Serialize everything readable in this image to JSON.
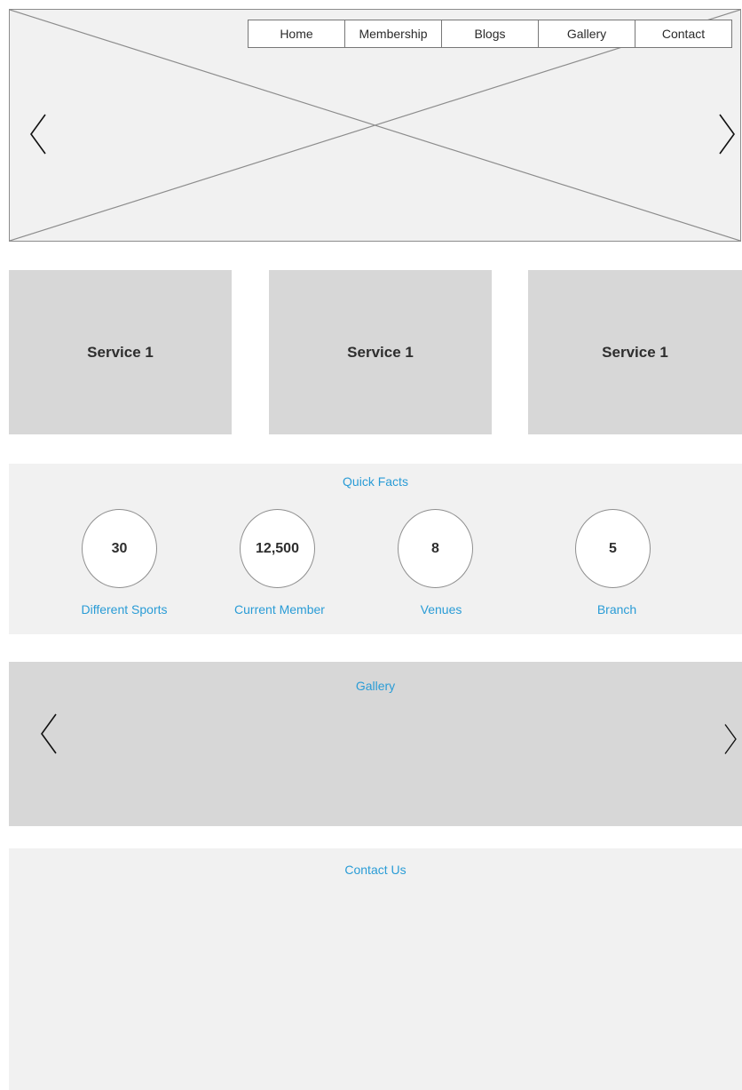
{
  "nav": {
    "items": [
      "Home",
      "Membership",
      "Blogs",
      "Gallery",
      "Contact"
    ]
  },
  "hero": {
    "prev_icon": "chevron-left-icon",
    "next_icon": "chevron-right-icon"
  },
  "services": [
    {
      "label": "Service 1"
    },
    {
      "label": "Service 1"
    },
    {
      "label": "Service 1"
    }
  ],
  "quick_facts": {
    "title": "Quick Facts",
    "items": [
      {
        "value": "30",
        "label": "Different Sports"
      },
      {
        "value": "12,500",
        "label": "Current Member"
      },
      {
        "value": "8",
        "label": "Venues"
      },
      {
        "value": "5",
        "label": "Branch"
      }
    ]
  },
  "gallery": {
    "title": "Gallery",
    "prev_icon": "chevron-left-icon",
    "next_icon": "chevron-right-icon"
  },
  "contact": {
    "title": "Contact Us"
  },
  "colors": {
    "accent": "#2a9cd6",
    "panel_light": "#f1f1f1",
    "panel_dark": "#d7d7d7",
    "border": "#8c8c8c"
  }
}
